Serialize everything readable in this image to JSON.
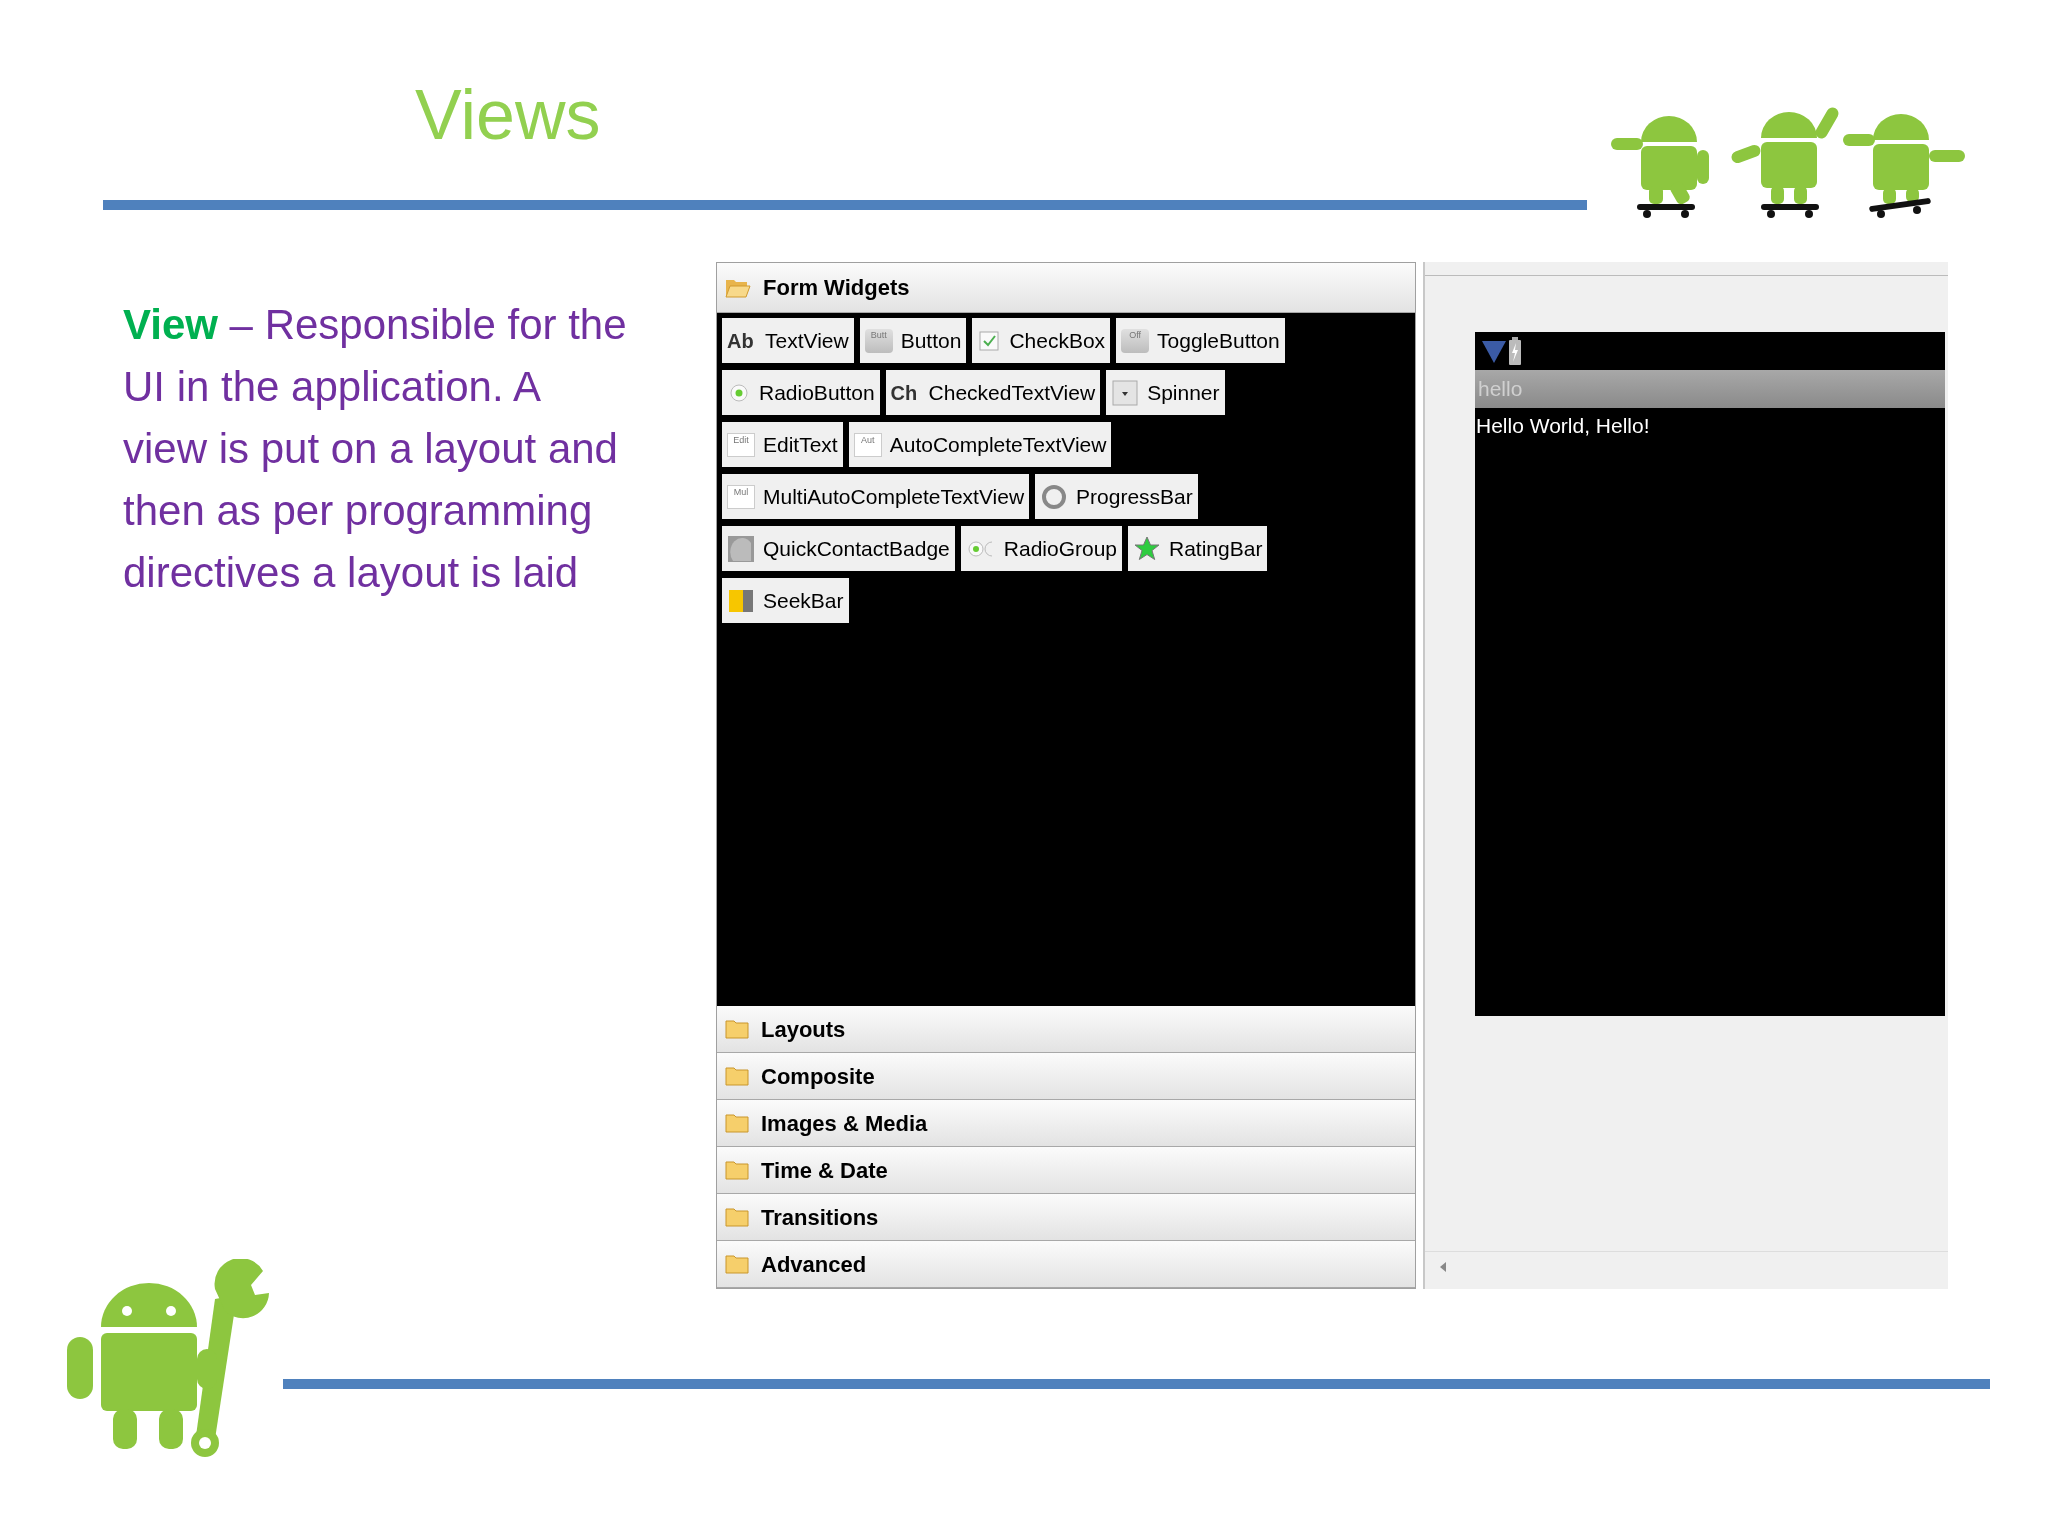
{
  "slide": {
    "title": "Views",
    "term": "View",
    "description": "– Responsible for the UI in the application. A view is put on a layout and then as per programming directives a layout is laid"
  },
  "palette": {
    "categories": [
      {
        "label": "Form Widgets",
        "expanded": true,
        "widget_rows": [
          [
            {
              "label": "TextView",
              "kind": "glyph",
              "icon_text": "Ab"
            },
            {
              "label": "Button",
              "kind": "button",
              "icon_text": "Butt"
            },
            {
              "label": "CheckBox",
              "kind": "checkbox"
            },
            {
              "label": "ToggleButton",
              "kind": "button",
              "icon_text": "Off"
            }
          ],
          [
            {
              "label": "RadioButton",
              "kind": "radio"
            },
            {
              "label": "CheckedTextView",
              "kind": "glyph",
              "icon_text": "Ch"
            },
            {
              "label": "Spinner",
              "kind": "spinner"
            }
          ],
          [
            {
              "label": "EditText",
              "kind": "field",
              "icon_text": "Edit"
            },
            {
              "label": "AutoCompleteTextView",
              "kind": "field",
              "icon_text": "Aut"
            }
          ],
          [
            {
              "label": "MultiAutoCompleteTextView",
              "kind": "field",
              "icon_text": "Mul"
            },
            {
              "label": "ProgressBar",
              "kind": "progress"
            }
          ],
          [
            {
              "label": "QuickContactBadge",
              "kind": "badge"
            },
            {
              "label": "RadioGroup",
              "kind": "radiogroup"
            },
            {
              "label": "RatingBar",
              "kind": "star"
            }
          ],
          [
            {
              "label": "SeekBar",
              "kind": "seekbar"
            }
          ]
        ]
      },
      {
        "label": "Layouts",
        "expanded": false
      },
      {
        "label": "Composite",
        "expanded": false
      },
      {
        "label": "Images & Media",
        "expanded": false
      },
      {
        "label": "Time & Date",
        "expanded": false
      },
      {
        "label": "Transitions",
        "expanded": false
      },
      {
        "label": "Advanced",
        "expanded": false
      }
    ]
  },
  "preview": {
    "app_title": "hello",
    "content_text": "Hello World, Hello!"
  }
}
